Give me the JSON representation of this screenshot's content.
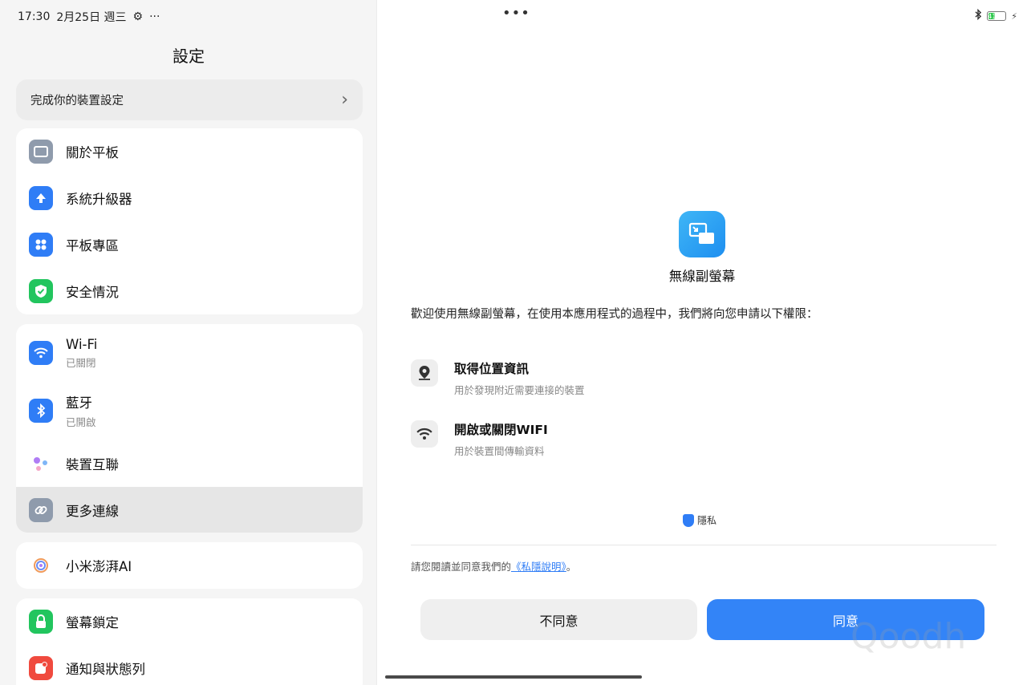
{
  "status_bar": {
    "time": "17:30",
    "date": "2月25日 週三",
    "more": "···",
    "battery": "41",
    "top_center_dots": "•••"
  },
  "settings": {
    "title": "設定",
    "setup_prompt": "完成你的裝置設定",
    "group1": [
      {
        "label": "關於平板",
        "icon": "tablet-icon",
        "color": "#8f9bac"
      },
      {
        "label": "系統升級器",
        "icon": "upload-icon",
        "color": "#2f7df6"
      },
      {
        "label": "平板專區",
        "icon": "grid-icon",
        "color": "#2f7df6"
      },
      {
        "label": "安全情況",
        "icon": "shield-icon",
        "color": "#22c55e"
      }
    ],
    "group2": [
      {
        "label": "Wi-Fi",
        "sub": "已關閉",
        "icon": "wifi-icon",
        "color": "#2f7df6"
      },
      {
        "label": "藍牙",
        "sub": "已開啟",
        "icon": "bluetooth-icon",
        "color": "#2f7df6"
      },
      {
        "label": "裝置互聯",
        "icon": "interconnect-icon"
      },
      {
        "label": "更多連線",
        "icon": "link-icon",
        "color": "#8f9bac",
        "selected": true
      }
    ],
    "group3": [
      {
        "label": "小米澎湃AI",
        "icon": "ai-icon"
      }
    ],
    "group4": [
      {
        "label": "螢幕鎖定",
        "icon": "lock-icon",
        "color": "#22c55e"
      },
      {
        "label": "通知與狀態列",
        "icon": "notification-icon",
        "color": "#f04a3e"
      }
    ]
  },
  "dialog": {
    "app_name": "無線副螢幕",
    "intro": "歡迎使用無線副螢幕，在使用本應用程式的過程中，我們將向您申請以下權限：",
    "permissions": [
      {
        "title": "取得位置資訊",
        "desc": "用於發現附近需要連接的裝置",
        "icon": "location-icon"
      },
      {
        "title": "開啟或關閉WIFI",
        "desc": "用於裝置間傳輸資料",
        "icon": "wifi-icon"
      }
    ],
    "privacy_label": "隱私",
    "consent_prefix": "請您閱讀並同意我們的",
    "consent_link": "《私隱說明》",
    "consent_suffix": "。",
    "disagree_label": "不同意",
    "agree_label": "同意"
  },
  "watermark": "Qoodh"
}
